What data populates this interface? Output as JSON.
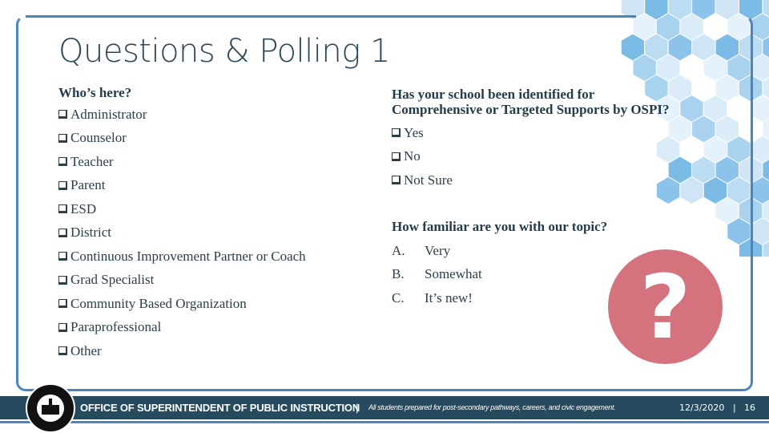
{
  "slide": {
    "title": "Questions & Polling 1"
  },
  "poll_who": {
    "heading": "Who’s here?",
    "options": [
      "Administrator",
      "Counselor",
      "Teacher",
      "Parent",
      "ESD",
      "District",
      "Continuous Improvement Partner or Coach",
      "Grad Specialist",
      "Community Based Organization",
      "Paraprofessional",
      "Other"
    ]
  },
  "poll_identified": {
    "heading_line1": "Has your school been identified for",
    "heading_line2": "Comprehensive or Targeted Supports by OSPI?",
    "options": [
      "Yes",
      "No",
      "Not Sure"
    ]
  },
  "poll_familiar": {
    "heading": "How familiar are you with our topic?",
    "options": [
      {
        "letter": "A.",
        "label": "Very"
      },
      {
        "letter": "B.",
        "label": "Somewhat"
      },
      {
        "letter": "C.",
        "label": "It’s new!"
      }
    ]
  },
  "graphic": {
    "icon": "question-mark-icon",
    "glyph": "?",
    "color": "#d4737e"
  },
  "footer": {
    "org": "OFFICE OF SUPERINTENDENT OF PUBLIC INSTRUCTION",
    "separator": "|",
    "tagline": "All students prepared for post-secondary pathways, careers, and civic engagement.",
    "date": "12/3/2020",
    "page": "16",
    "logo": "state-seal-icon"
  },
  "colors": {
    "frame": "#4a85bd",
    "footer_bar": "#264a5e",
    "text": "#243c4a"
  }
}
